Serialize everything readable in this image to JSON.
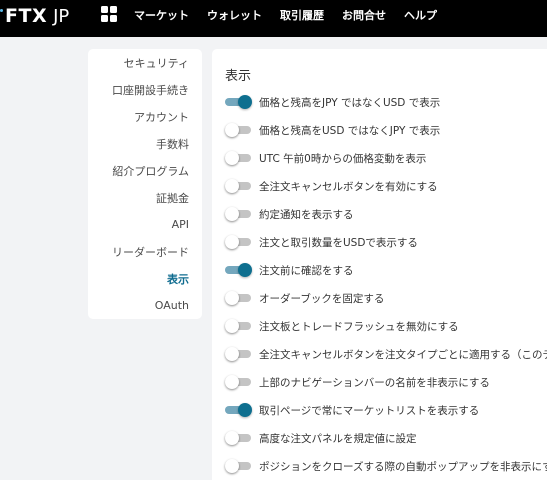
{
  "header": {
    "logo_text": "FTX",
    "logo_suffix": "JP",
    "nav": [
      "マーケット",
      "ウォレット",
      "取引履歴",
      "お問合せ",
      "ヘルプ"
    ]
  },
  "sidebar": {
    "items": [
      {
        "label": "セキュリティ",
        "active": false
      },
      {
        "label": "口座開設手続き",
        "active": false
      },
      {
        "label": "アカウント",
        "active": false
      },
      {
        "label": "手数料",
        "active": false
      },
      {
        "label": "紹介プログラム",
        "active": false
      },
      {
        "label": "証拠金",
        "active": false
      },
      {
        "label": "API",
        "active": false
      },
      {
        "label": "リーダーボード",
        "active": false
      },
      {
        "label": "表示",
        "active": true
      },
      {
        "label": "OAuth",
        "active": false
      }
    ]
  },
  "main": {
    "title": "表示",
    "settings": [
      {
        "label": "価格と残高をJPY ではなくUSD で表示",
        "enabled": true
      },
      {
        "label": "価格と残高をUSD ではなくJPY で表示",
        "enabled": false
      },
      {
        "label": "UTC 午前0時からの価格変動を表示",
        "enabled": false
      },
      {
        "label": "全注文キャンセルボタンを有効にする",
        "enabled": false
      },
      {
        "label": "約定通知を表示する",
        "enabled": false
      },
      {
        "label": "注文と取引数量をUSDで表示する",
        "enabled": false
      },
      {
        "label": "注文前に確認をする",
        "enabled": true
      },
      {
        "label": "オーダーブックを固定する",
        "enabled": false
      },
      {
        "label": "注文板とトレードフラッシュを無効にする",
        "enabled": false
      },
      {
        "label": "全注文キャンセルボタンを注文タイプごとに適用する（このデ",
        "enabled": false
      },
      {
        "label": "上部のナビゲーションバーの名前を非表示にする",
        "enabled": false
      },
      {
        "label": "取引ページで常にマーケットリストを表示する",
        "enabled": true
      },
      {
        "label": "高度な注文パネルを規定値に設定",
        "enabled": false
      },
      {
        "label": "ポジションをクローズする際の自動ポップアップを非表示にす",
        "enabled": false
      }
    ]
  },
  "colors": {
    "header_bg": "#000000",
    "accent": "#0e6f8f",
    "toggle_on_track": "#74a7bd",
    "page_bg": "#f2f3f5"
  }
}
